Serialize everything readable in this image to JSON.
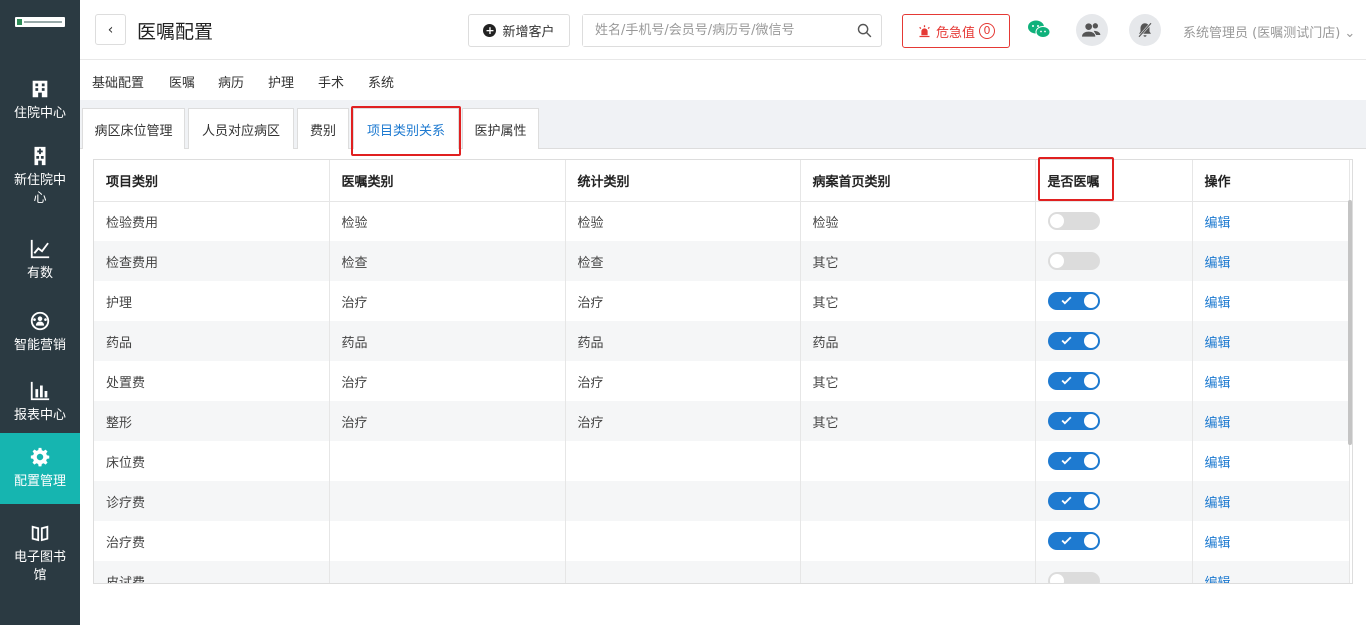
{
  "sidebar": {
    "items": [
      {
        "label": "住院中心",
        "icon": "hospital-building-icon",
        "active": false
      },
      {
        "label": "新住院中心",
        "icon": "hospital-icon",
        "active": false
      },
      {
        "label": "有数",
        "icon": "trend-chart-icon",
        "active": false
      },
      {
        "label": "智能营销",
        "icon": "marketing-icon",
        "active": false
      },
      {
        "label": "报表中心",
        "icon": "bar-chart-icon",
        "active": false
      },
      {
        "label": "配置管理",
        "icon": "gear-icon",
        "active": true
      },
      {
        "label": "电子图书馆",
        "icon": "book-icon",
        "active": false
      }
    ]
  },
  "header": {
    "back_icon": "chevron-left-icon",
    "title": "医嘱配置",
    "add_customer_label": "新增客户",
    "search_placeholder": "姓名/手机号/会员号/病历号/微信号",
    "critical_label": "危急值",
    "critical_count": "0",
    "user_label": "系统管理员 (医嘱测试门店)"
  },
  "tabs_primary": [
    "基础配置",
    "医嘱",
    "病历",
    "护理",
    "手术",
    "系统"
  ],
  "tabs_secondary": [
    "病区床位管理",
    "人员对应病区",
    "费别",
    "项目类别关系",
    "医护属性"
  ],
  "active_secondary": "项目类别关系",
  "table": {
    "columns": [
      "项目类别",
      "医嘱类别",
      "统计类别",
      "病案首页类别",
      "是否医嘱",
      "操作"
    ],
    "rows": [
      {
        "item": "检验费用",
        "order": "检验",
        "stat": "检验",
        "record": "检验",
        "is_order": false,
        "action": "编辑"
      },
      {
        "item": "检查费用",
        "order": "检查",
        "stat": "检查",
        "record": "其它",
        "is_order": false,
        "action": "编辑"
      },
      {
        "item": "护理",
        "order": "治疗",
        "stat": "治疗",
        "record": "其它",
        "is_order": true,
        "action": "编辑"
      },
      {
        "item": "药品",
        "order": "药品",
        "stat": "药品",
        "record": "药品",
        "is_order": true,
        "action": "编辑"
      },
      {
        "item": "处置费",
        "order": "治疗",
        "stat": "治疗",
        "record": "其它",
        "is_order": true,
        "action": "编辑"
      },
      {
        "item": "整形",
        "order": "治疗",
        "stat": "治疗",
        "record": "其它",
        "is_order": true,
        "action": "编辑"
      },
      {
        "item": "床位费",
        "order": "",
        "stat": "",
        "record": "",
        "is_order": true,
        "action": "编辑"
      },
      {
        "item": "诊疗费",
        "order": "",
        "stat": "",
        "record": "",
        "is_order": true,
        "action": "编辑"
      },
      {
        "item": "治疗费",
        "order": "",
        "stat": "",
        "record": "",
        "is_order": true,
        "action": "编辑"
      },
      {
        "item": "皮试费",
        "order": "",
        "stat": "",
        "record": "",
        "is_order": false,
        "action": "编辑"
      }
    ]
  },
  "colors": {
    "sidebar": "#2b3a42",
    "active": "#16b5b0",
    "primary": "#1e7ad0",
    "danger": "#e53935"
  }
}
